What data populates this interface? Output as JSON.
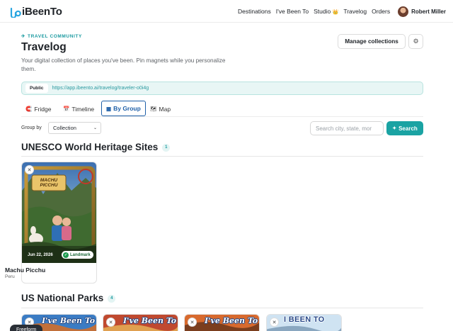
{
  "nav": {
    "brand": "iBeenTo",
    "links": [
      "Destinations",
      "I've Been To",
      "Studio",
      "Travelog",
      "Orders"
    ],
    "studio_badge": "👑",
    "user_name": "Robert Miller"
  },
  "header": {
    "kicker": "TRAVEL COMMUNITY",
    "title": "Travelog",
    "subtitle": "Your digital collection of places you've been. Pin magnets while you personalize them.",
    "manage_label": "Manage collections",
    "gear_icon": "⚙"
  },
  "public_bar": {
    "tag": "Public",
    "url": "https://app.ibeento.ai/travelog/traveler-o0i4g"
  },
  "tabs": [
    {
      "label": "Fridge",
      "icon": "🧲"
    },
    {
      "label": "Timeline",
      "icon": "📅"
    },
    {
      "label": "By Group",
      "icon": "▦"
    },
    {
      "label": "Map",
      "icon": "🗺"
    }
  ],
  "filters": {
    "group_by_label": "Group by",
    "group_by_value": "Collection",
    "search_placeholder": "Search city, state, mor",
    "search_button": "Search",
    "search_icon": "✦"
  },
  "sections": [
    {
      "title": "UNESCO World Heritage Sites",
      "count": "1"
    },
    {
      "title": "US National Parks",
      "count": "4"
    }
  ],
  "card": {
    "art_title": "MACHU PICCHU",
    "date": "Jun 22, 2026",
    "badge": "Landmark",
    "name": "Machu Picchu",
    "country": "Peru"
  },
  "mini_cards": [
    {
      "art_text": "I've Been To"
    },
    {
      "art_text": "I've Been To"
    },
    {
      "art_text": "I've Been To"
    },
    {
      "art_text": "I BEEN TO"
    }
  ],
  "freeform_label": "Freeform",
  "colors": {
    "teal": "#1aa3a3",
    "blue_active": "#1e5fa8",
    "landmark_green": "#1e9a4e"
  }
}
